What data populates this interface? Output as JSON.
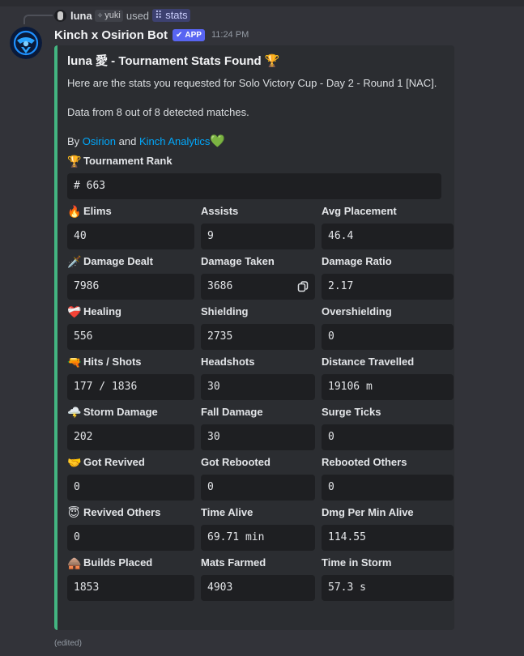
{
  "reply": {
    "username": "luna",
    "tag": "yuki",
    "used_text": "used",
    "command": "stats",
    "command_icon": "slash-command-icon"
  },
  "header": {
    "bot_name": "Kinch x Osirion Bot",
    "app_badge": "APP",
    "timestamp": "11:24 PM"
  },
  "embed": {
    "accent_color": "#43b581",
    "title": "luna 愛 - Tournament Stats Found 🏆",
    "desc_line1": "Here are the stats you requested for Solo Victory Cup - Day 2 - Round 1 [NAC].",
    "desc_line2": "Data from 8 out of 8 detected matches.",
    "by_prefix": "By",
    "link1": "Osirion",
    "and_text": "and",
    "link2": "Kinch Analytics",
    "heart": "💚",
    "rank_field": {
      "emoji": "🏆",
      "name": "Tournament Rank",
      "value": "# 663"
    },
    "rows": [
      [
        {
          "emoji": "🔥",
          "name": "Elims",
          "value": "40"
        },
        {
          "name": "Assists",
          "value": "9"
        },
        {
          "name": "Avg Placement",
          "value": "46.4"
        }
      ],
      [
        {
          "emoji": "🗡️",
          "name": "Damage Dealt",
          "value": "7986"
        },
        {
          "name": "Damage Taken",
          "value": "3686"
        },
        {
          "name": "Damage Ratio",
          "value": "2.17"
        }
      ],
      [
        {
          "emoji": "❤️‍🩹",
          "name": "Healing",
          "value": "556"
        },
        {
          "name": "Shielding",
          "value": "2735"
        },
        {
          "name": "Overshielding",
          "value": "0"
        }
      ],
      [
        {
          "emoji": "🔫",
          "name": "Hits / Shots",
          "value": "177 / 1836"
        },
        {
          "name": "Headshots",
          "value": "30"
        },
        {
          "name": "Distance Travelled",
          "value": "19106 m"
        }
      ],
      [
        {
          "emoji": "🌩️",
          "name": "Storm Damage",
          "value": "202"
        },
        {
          "name": "Fall Damage",
          "value": "30"
        },
        {
          "name": "Surge Ticks",
          "value": "0"
        }
      ],
      [
        {
          "emoji": "🤝",
          "name": "Got Revived",
          "value": "0"
        },
        {
          "name": "Got Rebooted",
          "value": "0"
        },
        {
          "name": "Rebooted Others",
          "value": "0"
        }
      ],
      [
        {
          "emoji": "😇",
          "name": "Revived Others",
          "value": "0"
        },
        {
          "name": "Time Alive",
          "value": "69.71 min"
        },
        {
          "name": "Dmg Per Min Alive",
          "value": "114.55"
        }
      ],
      [
        {
          "emoji": "🛖",
          "name": "Builds Placed",
          "value": "1853"
        },
        {
          "name": "Mats Farmed",
          "value": "4903"
        },
        {
          "name": "Time in Storm",
          "value": "57.3 s"
        }
      ]
    ]
  },
  "edited": "(edited)"
}
